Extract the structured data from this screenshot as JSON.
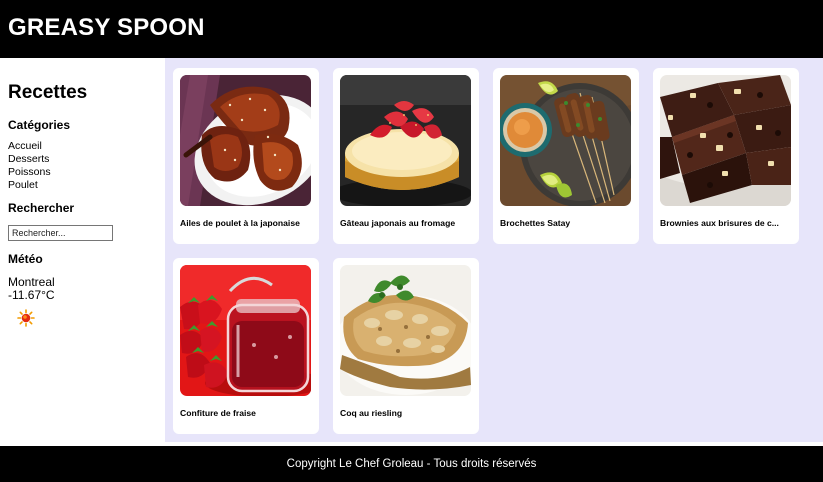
{
  "header": {
    "brand": "GREASY SPOON"
  },
  "sidebar": {
    "title": "Recettes",
    "categories_heading": "Catégories",
    "categories": [
      "Accueil",
      "Desserts",
      "Poissons",
      "Poulet"
    ],
    "search_heading": "Rechercher",
    "search_placeholder": "Rechercher...",
    "weather_heading": "Météo",
    "city": "Montreal",
    "temperature": "-11.67°C",
    "weather_icon": "sun-icon"
  },
  "recipes": [
    {
      "name": "Ailes de poulet à la japonaise",
      "image": "chicken-wings-photo"
    },
    {
      "name": "Gâteau japonais au fromage",
      "image": "cheesecake-photo"
    },
    {
      "name": "Brochettes Satay",
      "image": "satay-skewers-photo"
    },
    {
      "name": "Brownies aux brisures de c...",
      "image": "brownies-photo"
    },
    {
      "name": "Confiture de fraise",
      "image": "strawberry-jam-photo"
    },
    {
      "name": "Coq au riesling",
      "image": "coq-au-riesling-photo"
    }
  ],
  "footer": {
    "copyright": "Copyright Le Chef Groleau - Tous droits réservés"
  },
  "colors": {
    "header_bg": "#000000",
    "main_bg": "#e7e5fa",
    "card_bg": "#ffffff"
  }
}
